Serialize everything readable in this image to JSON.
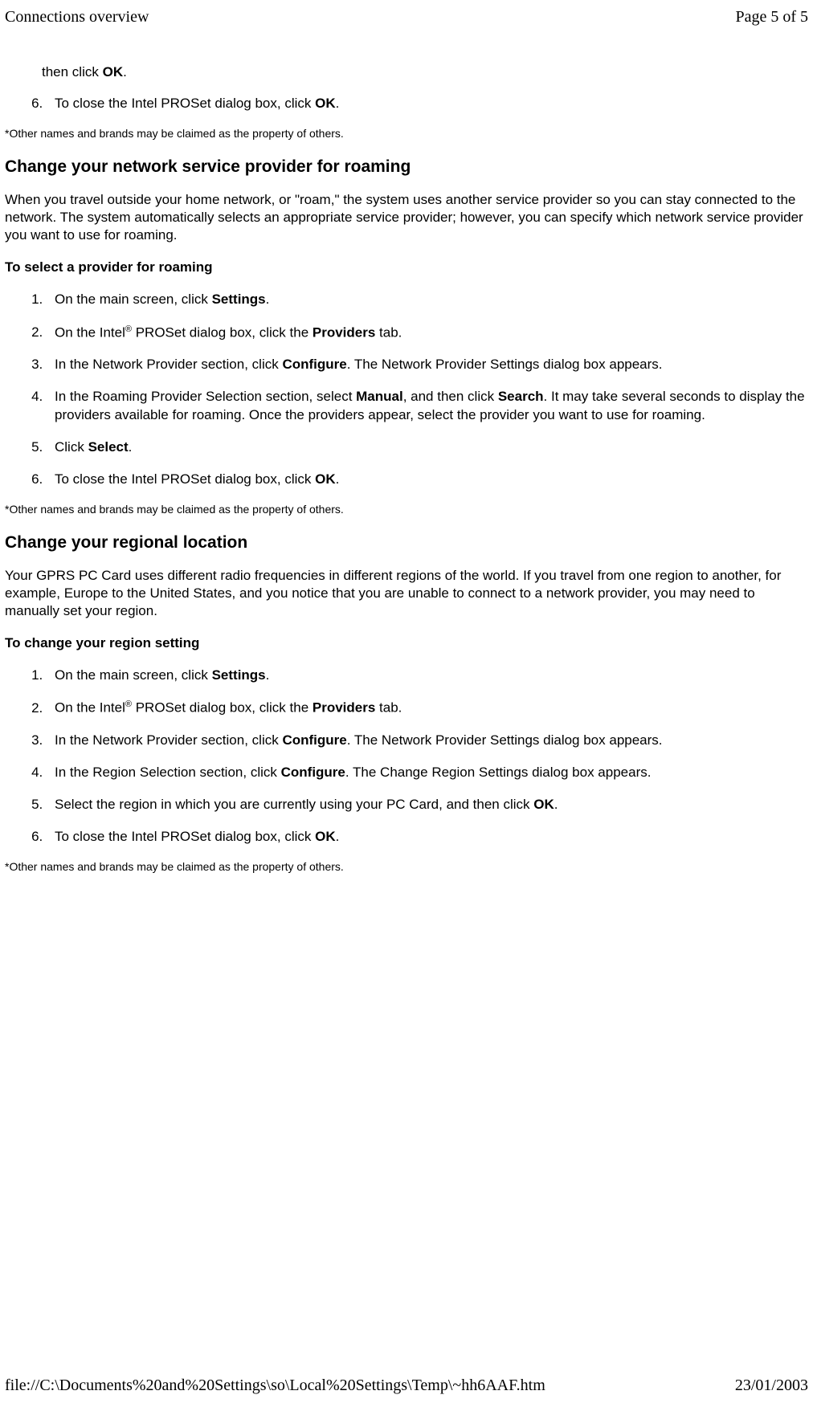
{
  "header": {
    "title": "Connections overview",
    "page": "Page 5 of 5"
  },
  "footer": {
    "path": "file://C:\\Documents%20and%20Settings\\so\\Local%20Settings\\Temp\\~hh6AAF.htm",
    "date": "23/01/2003"
  },
  "top_continuation": {
    "fragment_pre": "then click ",
    "fragment_bold": "OK",
    "fragment_post": ".",
    "step6_pre": "To close the Intel PROSet dialog box, click ",
    "step6_bold": "OK",
    "step6_post": "."
  },
  "footnote": "*Other names and brands may be claimed as the property of others.",
  "section_roaming": {
    "heading": "Change your network service provider for roaming",
    "para": "When you travel outside your home network, or \"roam,\" the system uses another service provider so you can stay connected to the network. The system automatically selects an appropriate service provider; however, you can specify which network service provider you want to use for roaming.",
    "subhead": "To select a provider for roaming",
    "steps": {
      "s1_pre": "On the main screen, click ",
      "s1_b": "Settings",
      "s1_post": ".",
      "s2_pre": "On the Intel",
      "s2_mid": " PROSet dialog box, click the ",
      "s2_b": "Providers",
      "s2_post": " tab.",
      "s3_pre": "In the Network Provider section, click ",
      "s3_b": "Configure",
      "s3_post": ". The Network Provider Settings dialog box appears.",
      "s4_pre": "In the Roaming Provider Selection section, select ",
      "s4_b1": "Manual",
      "s4_mid": ", and then click ",
      "s4_b2": "Search",
      "s4_post": ". It may take several seconds to display the providers available for roaming. Once the providers appear, select the provider you want to use for roaming.",
      "s5_pre": "Click ",
      "s5_b": "Select",
      "s5_post": ".",
      "s6_pre": "To close the Intel PROSet dialog box, click ",
      "s6_b": "OK",
      "s6_post": "."
    }
  },
  "section_region": {
    "heading": "Change your regional location",
    "para": "Your GPRS PC Card uses different radio frequencies in different regions of the world. If you travel from one region to another, for example, Europe to the United States, and you notice that you are unable to connect to a network provider, you may need to manually set your region.",
    "subhead": "To change your region setting",
    "steps": {
      "s1_pre": "On the main screen, click ",
      "s1_b": "Settings",
      "s1_post": ".",
      "s2_pre": "On the Intel",
      "s2_mid": " PROSet dialog box, click the ",
      "s2_b": "Providers",
      "s2_post": " tab.",
      "s3_pre": "In the Network Provider section, click ",
      "s3_b": "Configure",
      "s3_post": ". The Network Provider Settings dialog box appears.",
      "s4_pre": "In the Region Selection section, click ",
      "s4_b": "Configure",
      "s4_post": ". The Change Region Settings dialog box appears.",
      "s5_pre": "Select the region in which you are currently using your PC Card, and then click ",
      "s5_b": "OK",
      "s5_post": ".",
      "s6_pre": "To close the Intel PROSet dialog box, click ",
      "s6_b": "OK",
      "s6_post": "."
    }
  },
  "reg_mark": "®"
}
